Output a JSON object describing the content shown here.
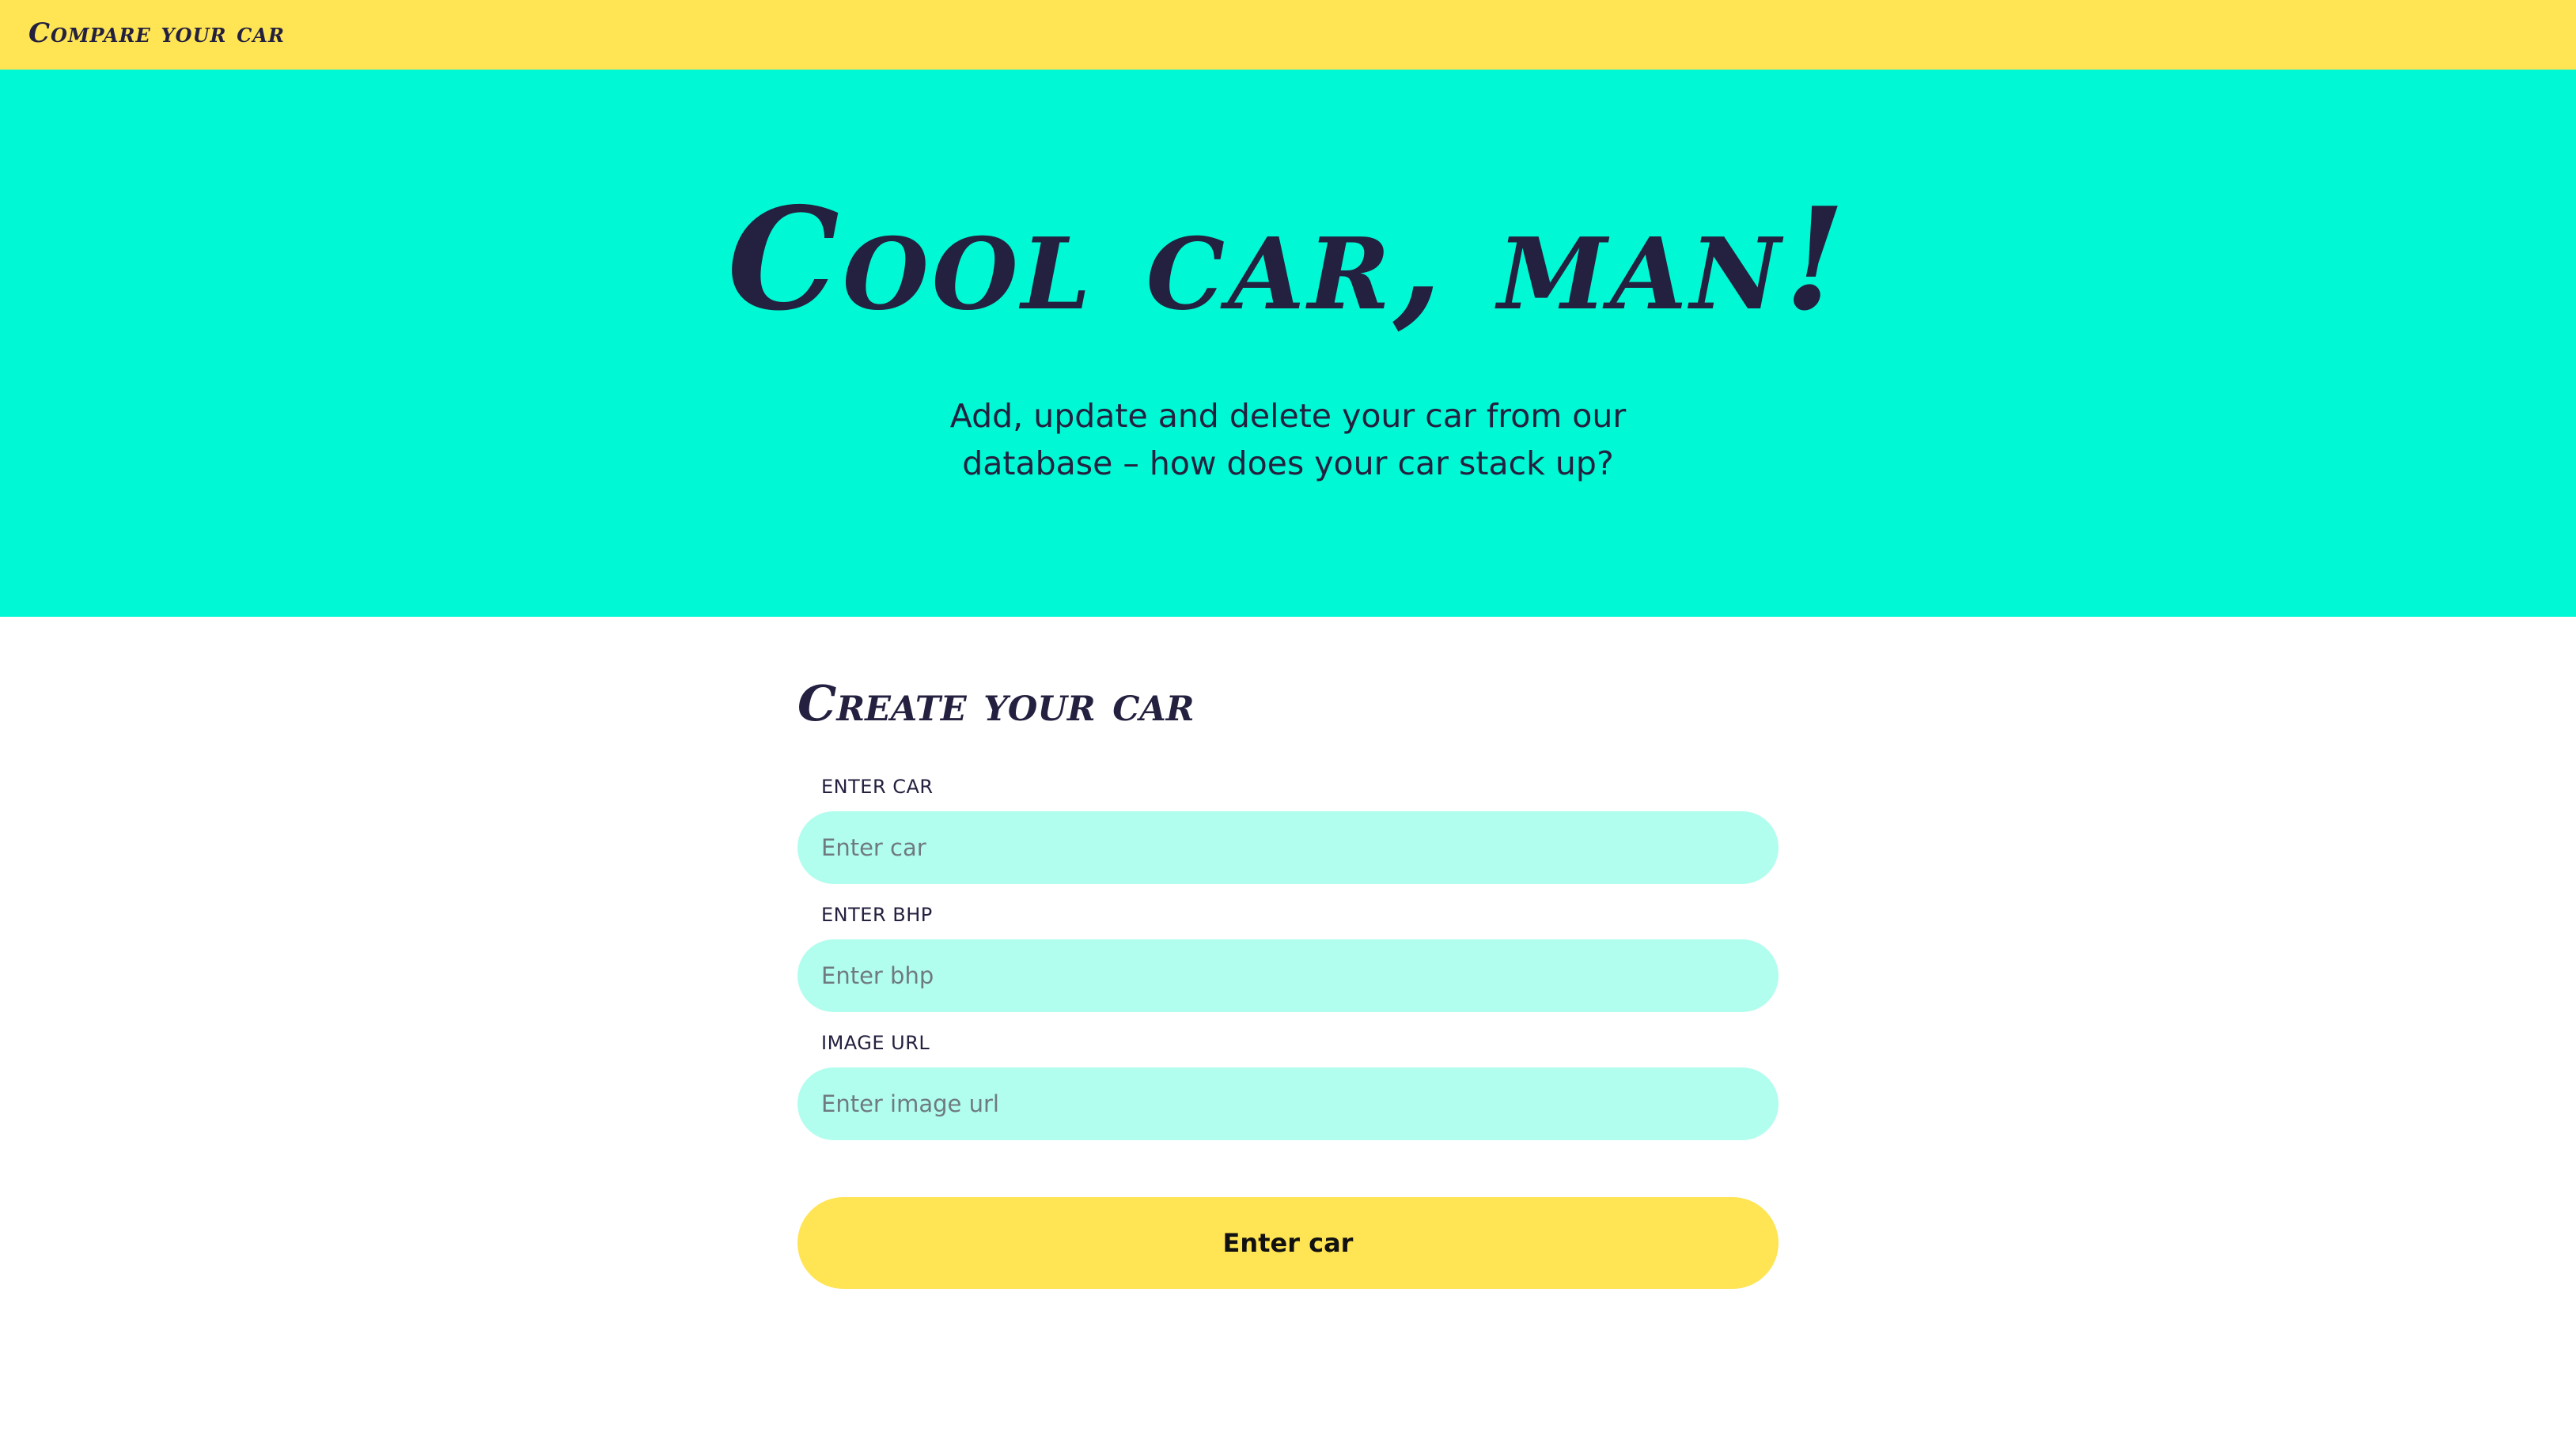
{
  "header": {
    "brand": "Compare your car"
  },
  "hero": {
    "title": "Cool car, man!",
    "subtitle": "Add, update and delete your car from our database – how does your car stack up?"
  },
  "form": {
    "title": "Create your car",
    "fields": [
      {
        "label": "ENTER CAR",
        "placeholder": "Enter car",
        "value": ""
      },
      {
        "label": "ENTER BHP",
        "placeholder": "Enter bhp",
        "value": ""
      },
      {
        "label": "IMAGE URL",
        "placeholder": "Enter image url",
        "value": ""
      }
    ],
    "submit_label": "Enter car"
  },
  "colors": {
    "header_bg": "#ffe454",
    "hero_bg": "#00f8d4",
    "input_bg": "#b1fdee",
    "button_bg": "#ffe454",
    "text_dark": "#23213f"
  }
}
